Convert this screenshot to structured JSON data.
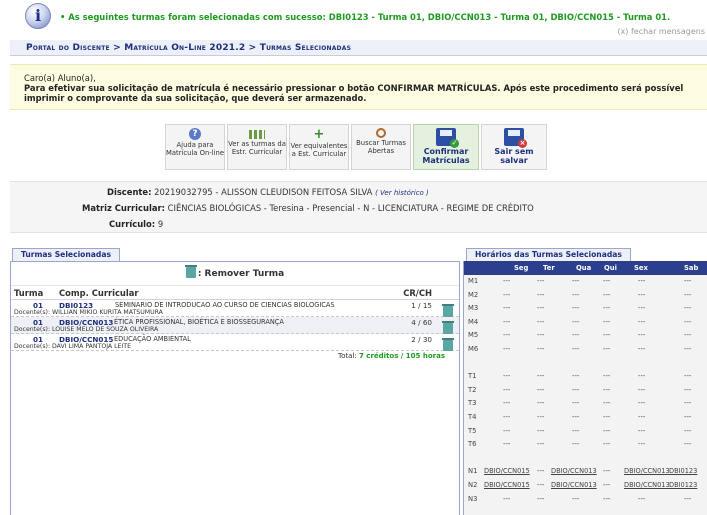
{
  "banner": {
    "message": "• As seguintes turmas foram selecionadas com sucesso: DBI0123 - Turma 01, DBIO/CCN013 - Turma 01, DBIO/CCN015 - Turma 01.",
    "close": "(x) fechar mensagens"
  },
  "breadcrumb": "Portal do Discente > Matrícula On-Line 2021.2 > Turmas Selecionadas",
  "notice": {
    "greeting": "Caro(a) Aluno(a),",
    "line1": "Para efetivar sua solicitação de matrícula é necessário pressionar o botão CONFIRMAR MATRÍCULAS. Após este procedimento será possível",
    "line2": "imprimir o comprovante da sua solicitação, que deverá ser armazenado."
  },
  "toolbar": [
    {
      "label": "Ajuda para Matrícula On-line",
      "icon": "help-icon"
    },
    {
      "label": "Ver as turmas da Estr. Curricular",
      "icon": "grid-icon"
    },
    {
      "label": "Ver equivalentes a Est. Curricular",
      "icon": "plus-icon"
    },
    {
      "label": "Buscar Turmas Abertas",
      "icon": "search-icon"
    },
    {
      "label": "Confirmar Matrículas",
      "icon": "save-check-icon"
    },
    {
      "label": "Sair sem salvar",
      "icon": "save-cancel-icon"
    }
  ],
  "student": {
    "discente_label": "Discente:",
    "discente_value": "20219032795 - ALISSON CLEUDISON FEITOSA SILVA",
    "historico_link": "( Ver histórico )",
    "matriz_label": "Matriz Curricular:",
    "matriz_value": "CIÊNCIAS BIOLÓGICAS - Teresina - Presencial - N - LICENCIATURA - REGIME DE CRÉDITO",
    "curriculo_label": "Currículo:",
    "curriculo_value": "9"
  },
  "selected": {
    "tab": "Turmas Selecionadas",
    "remove_label": ": Remover Turma",
    "headers": {
      "turma": "Turma",
      "comp": "Comp. Curricular",
      "crch": "CR/CH"
    },
    "rows": [
      {
        "turma": "01",
        "code": "DBI0123",
        "name": "SEMINARIO DE INTRODUCAO AO CURSO DE CIENCIAS BIOLOGICAS",
        "crch": "1 / 15",
        "docente": "Docente(s): WILLIAN MIKIO KURITA MATSUMURA"
      },
      {
        "turma": "01",
        "code": "DBIO/CCN013",
        "name": "ÉTICA PROFISSIONAL, BIOÉTICA E BIOSSEGURANÇA",
        "crch": "4 / 60",
        "docente": "Docente(s): LOUISE MELO DE SOUZA OLIVEIRA"
      },
      {
        "turma": "01",
        "code": "DBIO/CCN015",
        "name": "EDUCAÇÃO AMBIENTAL",
        "crch": "2 / 30",
        "docente": "Docente(s): DAVI LIMA PANTOJA LEITE"
      }
    ],
    "total_label": "Total:",
    "total_value": "7 créditos / 105 horas"
  },
  "schedule": {
    "tab": "Horários das Turmas Selecionadas",
    "days": [
      "Seg",
      "Ter",
      "Qua",
      "Qui",
      "Sex",
      "Sab"
    ],
    "rows": [
      {
        "slot": "M1",
        "cells": [
          "---",
          "---",
          "---",
          "---",
          "---",
          "---"
        ]
      },
      {
        "slot": "M2",
        "cells": [
          "---",
          "---",
          "---",
          "---",
          "---",
          "---"
        ]
      },
      {
        "slot": "M3",
        "cells": [
          "---",
          "---",
          "---",
          "---",
          "---",
          "---"
        ]
      },
      {
        "slot": "M4",
        "cells": [
          "---",
          "---",
          "---",
          "---",
          "---",
          "---"
        ]
      },
      {
        "slot": "M5",
        "cells": [
          "---",
          "---",
          "---",
          "---",
          "---",
          "---"
        ]
      },
      {
        "slot": "M6",
        "cells": [
          "---",
          "---",
          "---",
          "---",
          "---",
          "---"
        ]
      },
      {
        "slot": "",
        "cells": [
          "",
          "",
          "",
          "",
          "",
          ""
        ]
      },
      {
        "slot": "T1",
        "cells": [
          "---",
          "---",
          "---",
          "---",
          "---",
          "---"
        ]
      },
      {
        "slot": "T2",
        "cells": [
          "---",
          "---",
          "---",
          "---",
          "---",
          "---"
        ]
      },
      {
        "slot": "T3",
        "cells": [
          "---",
          "---",
          "---",
          "---",
          "---",
          "---"
        ]
      },
      {
        "slot": "T4",
        "cells": [
          "---",
          "---",
          "---",
          "---",
          "---",
          "---"
        ]
      },
      {
        "slot": "T5",
        "cells": [
          "---",
          "---",
          "---",
          "---",
          "---",
          "---"
        ]
      },
      {
        "slot": "T6",
        "cells": [
          "---",
          "---",
          "---",
          "---",
          "---",
          "---"
        ]
      },
      {
        "slot": "",
        "cells": [
          "",
          "",
          "",
          "",
          "",
          ""
        ]
      },
      {
        "slot": "N1",
        "cells": [
          "DBIO/CCN015",
          "---",
          "DBIO/CCN013",
          "---",
          "DBIO/CCN013",
          "DBI0123"
        ]
      },
      {
        "slot": "N2",
        "cells": [
          "DBIO/CCN015",
          "---",
          "DBIO/CCN013",
          "---",
          "DBIO/CCN013",
          "DBI0123"
        ]
      },
      {
        "slot": "N3",
        "cells": [
          "---",
          "---",
          "---",
          "---",
          "---",
          "---"
        ]
      }
    ]
  }
}
